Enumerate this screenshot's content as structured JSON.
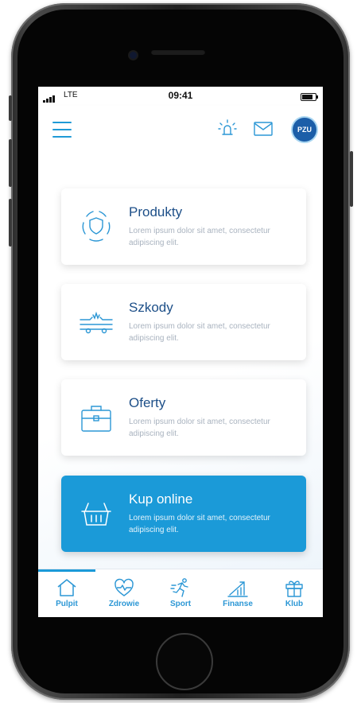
{
  "status_bar": {
    "carrier": "LTE",
    "time": "09:41"
  },
  "header": {
    "logo_text": "PZU",
    "icons": [
      "menu-icon",
      "alarm-icon",
      "mail-icon"
    ]
  },
  "cards": [
    {
      "title": "Produkty",
      "desc": "Lorem ipsum dolor sit amet, consectetur adipiscing elit.",
      "icon": "shield-icon"
    },
    {
      "title": "Szkody",
      "desc": "Lorem ipsum dolor sit amet, consectetur adipiscing elit.",
      "icon": "car-crash-icon"
    },
    {
      "title": "Oferty",
      "desc": "Lorem ipsum dolor sit amet, consectetur adipiscing elit.",
      "icon": "briefcase-icon"
    },
    {
      "title": "Kup online",
      "desc": "Lorem ipsum dolor sit amet, consectetur adipiscing elit.",
      "icon": "basket-icon"
    }
  ],
  "tabs": [
    {
      "label": "Pulpit",
      "icon": "home-icon",
      "active": true
    },
    {
      "label": "Zdrowie",
      "icon": "heart-icon",
      "active": false
    },
    {
      "label": "Sport",
      "icon": "runner-icon",
      "active": false
    },
    {
      "label": "Finanse",
      "icon": "chart-icon",
      "active": false
    },
    {
      "label": "Klub",
      "icon": "gift-icon",
      "active": false
    }
  ],
  "colors": {
    "accent": "#1b9ad8",
    "title": "#1d4f88",
    "muted": "#a9b3bf"
  }
}
